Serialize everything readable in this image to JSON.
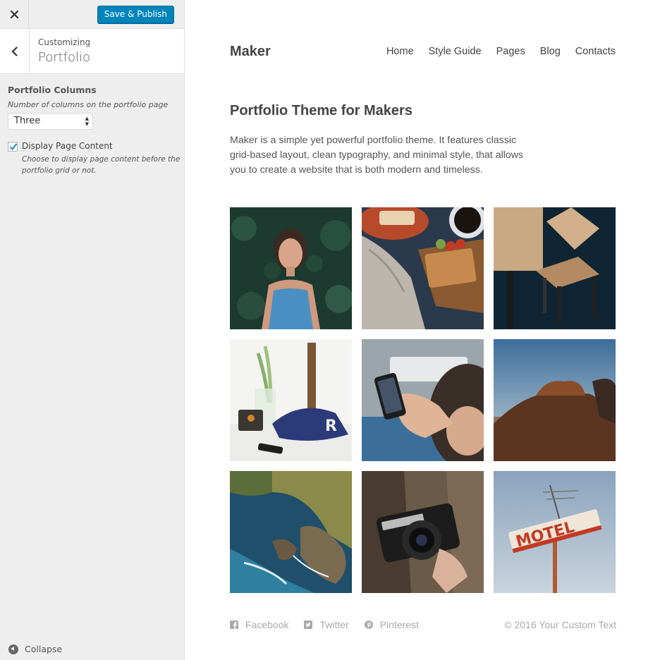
{
  "customizer": {
    "close_icon": "close-icon",
    "publish_label": "Save & Publish",
    "back_icon": "chevron-left-icon",
    "breadcrumb": "Customizing",
    "section_title": "Portfolio",
    "portfolio_columns": {
      "title": "Portfolio Columns",
      "description": "Number of columns on the portfolio page",
      "selected": "Three"
    },
    "display_page_content": {
      "label": "Display Page Content",
      "checked": true,
      "description": "Choose to display page content before the portfolio grid or not."
    },
    "collapse_label": "Collapse"
  },
  "site": {
    "title": "Maker",
    "nav": [
      "Home",
      "Style Guide",
      "Pages",
      "Blog",
      "Contacts"
    ],
    "page_title": "Portfolio Theme for Makers",
    "intro": "Maker is a simple yet powerful portfolio theme. It features classic grid-based layout, clean typography, and minimal style, that allows you to create a website that is both modern and timeless.",
    "portfolio_items": [
      "woman-in-leaves-photo",
      "toast-and-coffee-photo",
      "wooden-table-chair-photo",
      "desk-with-cap-photo",
      "person-with-phone-photo",
      "horse-on-beach-photo",
      "coastal-cliffs-photo",
      "vintage-camera-photo",
      "motel-sign-photo"
    ],
    "footer": {
      "social": [
        {
          "icon": "facebook-icon",
          "label": "Facebook"
        },
        {
          "icon": "twitter-icon",
          "label": "Twitter"
        },
        {
          "icon": "pinterest-icon",
          "label": "Pinterest"
        }
      ],
      "copyright": "© 2016 Your Custom Text"
    }
  },
  "colors": {
    "accent": "#0085ba",
    "sidebar_bg": "#eeeeee",
    "text": "#444444",
    "footer_text": "#aaaaaa"
  }
}
